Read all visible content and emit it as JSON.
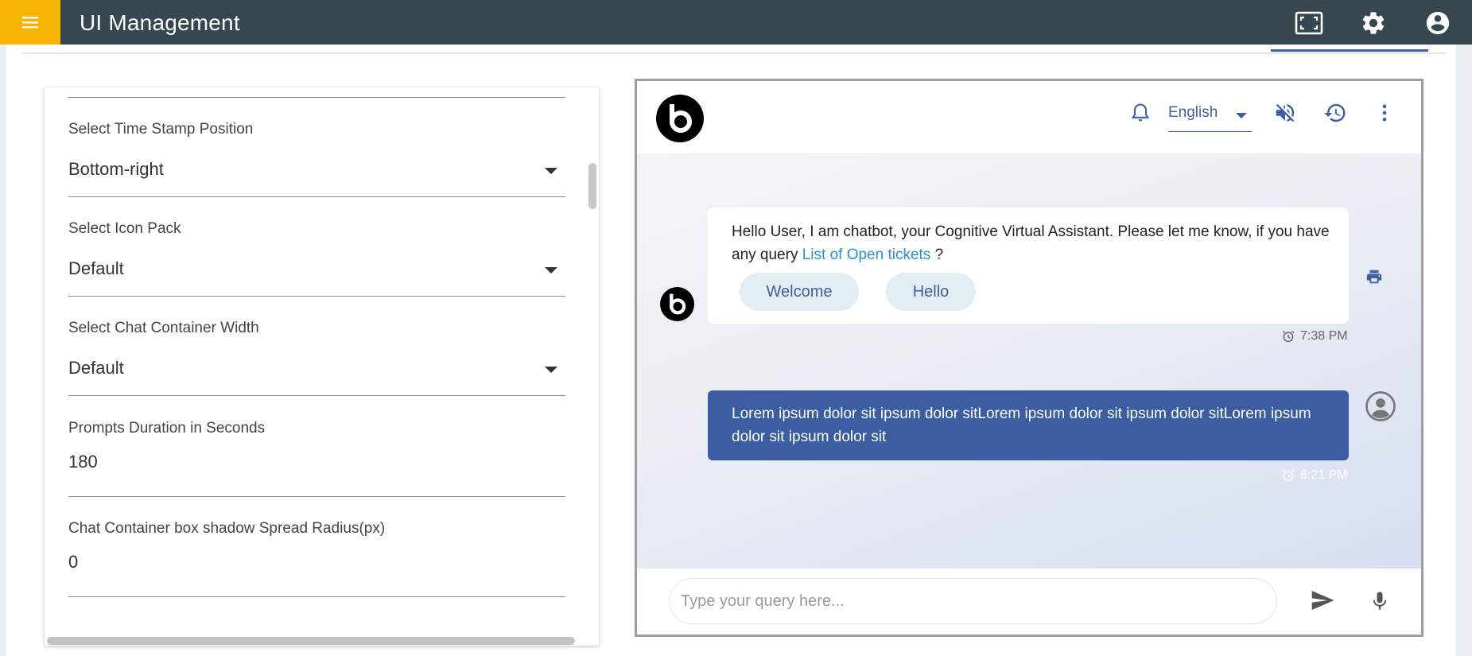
{
  "app": {
    "title": "UI Management"
  },
  "topbar": {
    "menu_icon": "menu-icon",
    "fullscreen_icon": "fullscreen-icon",
    "settings_icon": "gear-icon",
    "account_icon": "account-circle-icon",
    "accent_color": "#f4b400",
    "bar_color": "#37474f"
  },
  "settings": {
    "fields": [
      {
        "label": "Select Time Stamp Position",
        "value": "Bottom-right",
        "type": "select"
      },
      {
        "label": "Select Icon Pack",
        "value": "Default",
        "type": "select"
      },
      {
        "label": "Select Chat Container Width",
        "value": "Default",
        "type": "select"
      },
      {
        "label": "Prompts Duration in Seconds",
        "value": "180",
        "type": "input"
      },
      {
        "label": "Chat Container box shadow Spread Radius(px)",
        "value": "0",
        "type": "input"
      }
    ]
  },
  "chat": {
    "language": "English",
    "header_icons": [
      "bell-icon",
      "mute-icon",
      "history-icon",
      "more-vert-icon"
    ],
    "bot_message": {
      "text": "Hello User, I am chatbot, your Cognitive Virtual Assistant. Please let me know, if you have any query ",
      "link": "List of Open tickets",
      "suffix": " ?",
      "chips": [
        "Welcome",
        "Hello"
      ],
      "time": "7:38 PM"
    },
    "user_message": {
      "text": "Lorem ipsum dolor sit ipsum dolor sitLorem ipsum dolor sit ipsum dolor sitLorem ipsum dolor sit ipsum dolor sit",
      "time": "8:21 PM"
    },
    "input": {
      "placeholder": "Type your query here..."
    },
    "user_bubble_color": "#3b5ea3"
  }
}
